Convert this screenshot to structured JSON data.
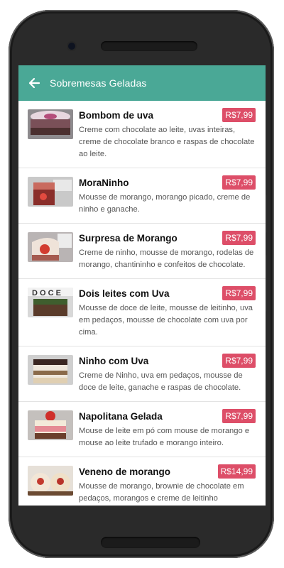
{
  "appbar": {
    "title": "Sobremesas Geladas",
    "color": "#4aa896"
  },
  "price_color": "#dd4e68",
  "items": [
    {
      "name": "Bombom de uva",
      "price": "R$7,99",
      "description": "Creme com chocolate ao leite, uvas inteiras, creme de chocolate branco e raspas de chocolate ao leite."
    },
    {
      "name": "MoraNinho",
      "price": "R$7,99",
      "description": "Mousse de morango, morango picado, creme de ninho e ganache."
    },
    {
      "name": "Surpresa de Morango",
      "price": "R$7,99",
      "description": "Creme de ninho, mousse de morango, rodelas de morango, chantininho e confeitos de chocolate."
    },
    {
      "name": "Dois leites com Uva",
      "price": "R$7,99",
      "description": "Mousse de doce de leite, mousse de leitinho, uva em pedaços, mousse de chocolate com uva por cima."
    },
    {
      "name": "Ninho com Uva",
      "price": "R$7,99",
      "description": "Creme de Ninho, uva em pedaços, mousse de doce de leite, ganache e raspas de chocolate."
    },
    {
      "name": "Napolitana Gelada",
      "price": "R$7,99",
      "description": "Mouse de leite em pó com mouse de morango e mouse ao leite trufado e morango inteiro."
    },
    {
      "name": "Veneno de morango",
      "price": "R$14,99",
      "description": "Mousse de morango, brownie de chocolate em pedaços, morangos e creme de leitinho"
    }
  ]
}
